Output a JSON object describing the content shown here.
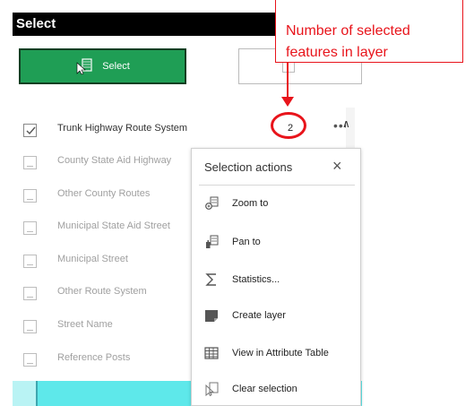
{
  "panel": {
    "title": "Select",
    "select_button_label": "Select"
  },
  "layers": [
    {
      "label": "Trunk Highway Route System",
      "checked": true,
      "count": "2",
      "more": "•••"
    },
    {
      "label": "County State Aid Highway",
      "checked": false
    },
    {
      "label": "Other County Routes",
      "checked": false
    },
    {
      "label": "Municipal State Aid Street",
      "checked": false
    },
    {
      "label": "Municipal Street",
      "checked": false
    },
    {
      "label": "Other Route System",
      "checked": false
    },
    {
      "label": "Street Name",
      "checked": false
    },
    {
      "label": "Reference Posts",
      "checked": false
    }
  ],
  "menu": {
    "title": "Selection actions",
    "close": "×",
    "items": [
      {
        "label": "Zoom to",
        "icon": "zoom-to-icon"
      },
      {
        "label": "Pan to",
        "icon": "pan-to-icon"
      },
      {
        "label": "Statistics...",
        "icon": "sigma-icon"
      },
      {
        "label": "Create layer",
        "icon": "create-layer-icon"
      },
      {
        "label": "View in Attribute Table",
        "icon": "table-icon"
      },
      {
        "label": "Clear selection",
        "icon": "clear-selection-icon"
      }
    ]
  },
  "scroll": {
    "up": "∧",
    "down": "∨"
  },
  "callout": {
    "line1": "Number of selected",
    "line2": "features in layer",
    "color": "#e8141b"
  },
  "colors": {
    "select_button": "#1f9e55",
    "header": "#000000",
    "map_strip": "#5ee8ea"
  }
}
